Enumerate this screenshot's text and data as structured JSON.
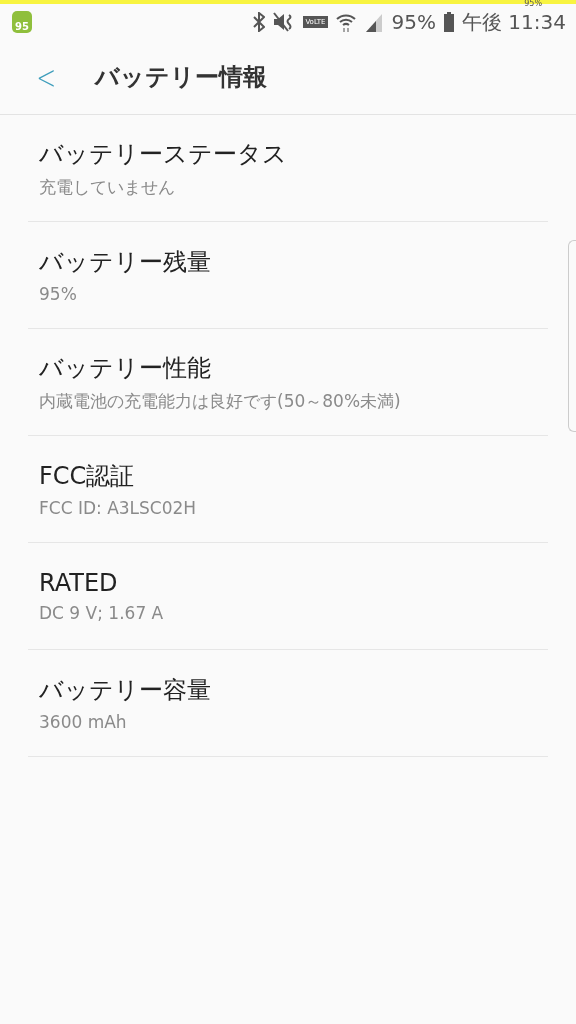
{
  "status_bar": {
    "top_battery": "95%",
    "app_badge": "95",
    "volte": "VoLTE",
    "battery": "95%",
    "time": "午後 11:34"
  },
  "header": {
    "back": "<",
    "title": "バッテリー情報"
  },
  "items": [
    {
      "title": "バッテリーステータス",
      "summary": "充電していません"
    },
    {
      "title": "バッテリー残量",
      "summary": "95%"
    },
    {
      "title": "バッテリー性能",
      "summary": "内蔵電池の充電能力は良好です(50～80%未満)"
    },
    {
      "title": "FCC認証",
      "summary": "FCC ID: A3LSC02H"
    },
    {
      "title": "RATED",
      "summary": "DC 9 V; 1.67 A"
    },
    {
      "title": "バッテリー容量",
      "summary": "3600 mAh"
    }
  ]
}
